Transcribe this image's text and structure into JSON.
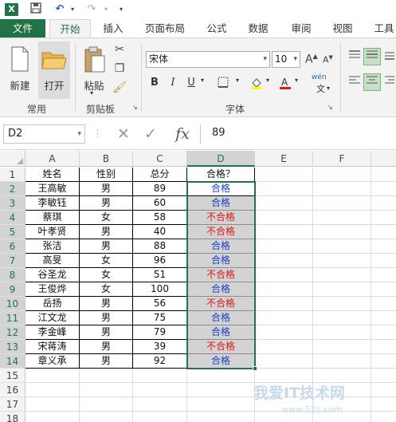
{
  "quick_access": {
    "logo": "X",
    "icons": [
      "save-icon",
      "undo-icon",
      "redo-icon",
      "customize-icon"
    ]
  },
  "tabs": [
    {
      "label": "文件"
    },
    {
      "label": "开始"
    },
    {
      "label": "插入"
    },
    {
      "label": "页面布局"
    },
    {
      "label": "公式"
    },
    {
      "label": "数据"
    },
    {
      "label": "审阅"
    },
    {
      "label": "视图"
    },
    {
      "label": "工具"
    }
  ],
  "ribbon": {
    "new_label": "新建",
    "open_label": "打开",
    "paste_label": "粘贴",
    "group_common": "常用",
    "group_clipboard": "剪贴板",
    "group_font": "字体",
    "font_name": "宋体",
    "font_size": "10",
    "bold": "B",
    "italic": "I",
    "underline": "U",
    "grow_font": "A",
    "shrink_font": "A",
    "phonetic": "wén"
  },
  "formula_bar": {
    "name_box": "D2",
    "cancel": "✕",
    "enter": "✓",
    "fx": "fx",
    "value": "89"
  },
  "sheet": {
    "columns": [
      "A",
      "B",
      "C",
      "D",
      "E",
      "F"
    ],
    "selected_column": "D",
    "rows": [
      "1",
      "2",
      "3",
      "4",
      "5",
      "6",
      "7",
      "8",
      "9",
      "10",
      "11",
      "12",
      "13",
      "14",
      "15",
      "16",
      "17",
      "18"
    ],
    "header": [
      "姓名",
      "性别",
      "总分",
      "合格？"
    ],
    "data": [
      [
        "王高敏",
        "男",
        "89",
        "合格"
      ],
      [
        "李敏钰",
        "男",
        "60",
        "合格"
      ],
      [
        "蔡琪",
        "女",
        "58",
        "不合格"
      ],
      [
        "叶孝贤",
        "男",
        "40",
        "不合格"
      ],
      [
        "张洁",
        "男",
        "88",
        "合格"
      ],
      [
        "高旻",
        "女",
        "96",
        "合格"
      ],
      [
        "谷圣龙",
        "女",
        "51",
        "不合格"
      ],
      [
        "王俊烨",
        "女",
        "100",
        "合格"
      ],
      [
        "岳扬",
        "男",
        "56",
        "不合格"
      ],
      [
        "江文龙",
        "男",
        "75",
        "合格"
      ],
      [
        "李金峰",
        "男",
        "79",
        "合格"
      ],
      [
        "宋蒋涛",
        "男",
        "39",
        "不合格"
      ],
      [
        "章义承",
        "男",
        "92",
        "合格"
      ]
    ]
  },
  "watermark": {
    "text": "我爱IT技术网",
    "url": "www.52ij.com"
  },
  "colors": {
    "excel_green": "#217346",
    "pass_blue": "#1a3fd1",
    "fail_red": "#e01818",
    "selection_gray": "#d3d3d3"
  }
}
